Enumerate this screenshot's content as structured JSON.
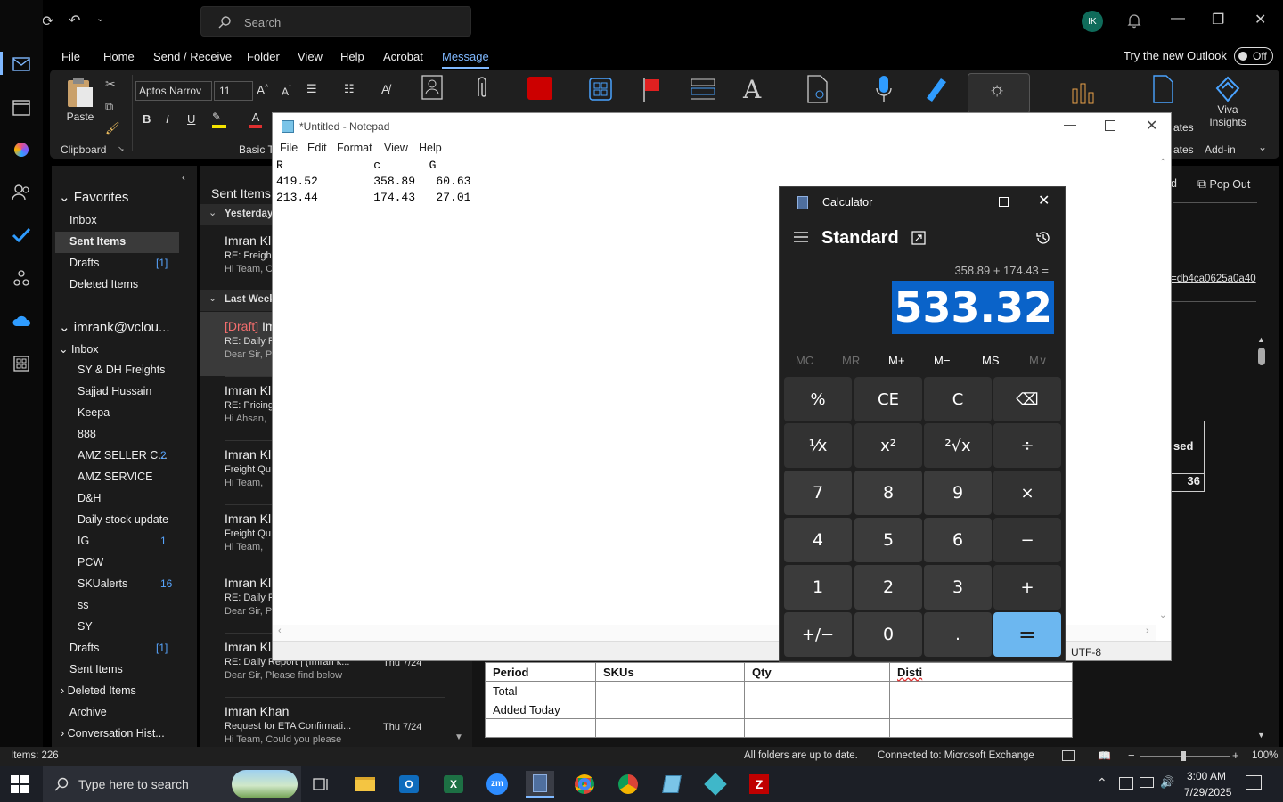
{
  "titlebar": {
    "search_placeholder": "Search",
    "avatar_initials": "IK"
  },
  "menubar": {
    "tabs": [
      "File",
      "Home",
      "Send / Receive",
      "Folder",
      "View",
      "Help",
      "Acrobat",
      "Message"
    ],
    "try_new": "Try the new Outlook",
    "toggle": "Off"
  },
  "ribbon": {
    "paste": "Paste",
    "clipboard": "Clipboard",
    "font_name": "Aptos Narrov",
    "font_size": "11",
    "basic_text": "Basic Te",
    "viva_line1": "Viva",
    "viva_line2": "Insights",
    "addin": "Add-in",
    "ates": "ates",
    "ates2": "ates"
  },
  "folders": {
    "favorites": "Favorites",
    "fav_items": [
      {
        "label": "Inbox",
        "count": ""
      },
      {
        "label": "Sent Items",
        "count": ""
      },
      {
        "label": "Drafts",
        "count": "[1]"
      },
      {
        "label": "Deleted Items",
        "count": ""
      }
    ],
    "account": "imrank@vclou...",
    "inbox": "Inbox",
    "inbox_sub": [
      {
        "label": "SY & DH Freights",
        "count": ""
      },
      {
        "label": "Sajjad Hussain",
        "count": ""
      },
      {
        "label": "Keepa",
        "count": ""
      },
      {
        "label": "888",
        "count": ""
      },
      {
        "label": "AMZ SELLER C...",
        "count": "2"
      },
      {
        "label": "AMZ SERVICE",
        "count": ""
      },
      {
        "label": "D&H",
        "count": ""
      },
      {
        "label": "Daily stock update",
        "count": ""
      },
      {
        "label": "IG",
        "count": "1"
      },
      {
        "label": "PCW",
        "count": ""
      },
      {
        "label": "SKUalerts",
        "count": "16"
      },
      {
        "label": "ss",
        "count": ""
      },
      {
        "label": "SY",
        "count": ""
      }
    ],
    "rest": [
      {
        "label": "Drafts",
        "count": "[1]"
      },
      {
        "label": "Sent Items",
        "count": ""
      },
      {
        "label": "Deleted Items",
        "count": ""
      },
      {
        "label": "Archive",
        "count": ""
      },
      {
        "label": "Conversation Hist...",
        "count": ""
      }
    ]
  },
  "messages": {
    "header": "Sent Items",
    "group_yesterday": "Yesterday",
    "group_lastweek": "Last Week",
    "items": [
      {
        "from": "Imran Kl",
        "subject": "RE: Freigh",
        "preview": "Hi Team,  C",
        "date": ""
      },
      {
        "from": "Imran Kl",
        "draft": "[Draft]",
        "subject": "RE: Daily R",
        "preview": "Dear Sir,  P",
        "date": ""
      },
      {
        "from": "Imran Kl",
        "subject": "RE: Pricing",
        "preview": "Hi Ahsan,",
        "date": ""
      },
      {
        "from": "Imran Kl",
        "subject": "Freight Qu",
        "preview": "Hi Team,",
        "date": ""
      },
      {
        "from": "Imran Kl",
        "subject": "Freight Qu",
        "preview": "Hi Team,",
        "date": ""
      },
      {
        "from": "Imran Kl",
        "subject": "RE: Daily R",
        "preview": "Dear Sir,  P",
        "date": ""
      },
      {
        "from": "Imran Kl",
        "subject": "RE: Daily Report | (Imran k...",
        "preview": "Dear Sir,  Please find below",
        "date": "Thu 7/24"
      },
      {
        "from": "Imran Khan",
        "subject": "Request for ETA Confirmati...",
        "preview": "Hi Team,  Could you please",
        "date": "Thu 7/24"
      }
    ]
  },
  "reading": {
    "popout_fragment": "d",
    "popout": "Pop Out",
    "link_fragment": "=db4ca0625a0a40",
    "side_fragment": "sed",
    "side_value": "36",
    "table_headers": [
      "Period",
      "SKUs",
      "Qty",
      "Disti"
    ],
    "table_rows": [
      [
        "Total",
        "",
        "",
        ""
      ],
      [
        "Added Today",
        "",
        "",
        ""
      ],
      [
        "",
        "",
        "",
        ""
      ]
    ]
  },
  "statusbar": {
    "items": "Items: 226",
    "sync": "All folders are up to date.",
    "connection": "Connected to: Microsoft Exchange",
    "zoom": "100%"
  },
  "taskbar": {
    "search_placeholder": "Type here to search",
    "time": "3:00 AM",
    "date": "7/29/2025"
  },
  "notepad": {
    "title": "*Untitled - Notepad",
    "menu": [
      "File",
      "Edit",
      "Format",
      "View",
      "Help"
    ],
    "text": "R             c       G\n419.52        358.89   60.63\n213.44        174.43   27.01",
    "encoding": "UTF-8"
  },
  "calculator": {
    "title": "Calculator",
    "mode": "Standard",
    "expression": "358.89 + 174.43 =",
    "display": "533.32",
    "memory": [
      "MC",
      "MR",
      "M+",
      "M−",
      "MS",
      "M∨"
    ],
    "keys": [
      [
        "%",
        "CE",
        "C",
        "⌫"
      ],
      [
        "⅟x",
        "x²",
        "²√x",
        "÷"
      ],
      [
        "7",
        "8",
        "9",
        "×"
      ],
      [
        "4",
        "5",
        "6",
        "−"
      ],
      [
        "1",
        "2",
        "3",
        "+"
      ],
      [
        "+/−",
        "0",
        ".",
        "="
      ]
    ]
  }
}
